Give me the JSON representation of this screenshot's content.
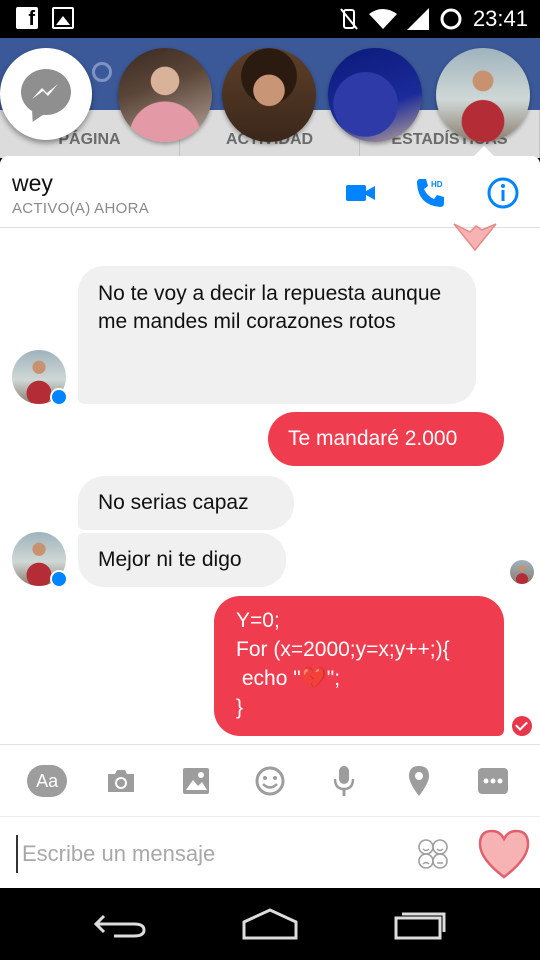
{
  "status_bar": {
    "time": "23:41"
  },
  "background_app": {
    "nav_items": [
      "PÁGINA",
      "ACTIVIDAD",
      "ESTADÍSTICAS"
    ]
  },
  "chat_header": {
    "name": "wey",
    "status": "ACTIVO(A) AHORA"
  },
  "messages": [
    {
      "from": "contact",
      "text": "No te voy a decir la repuesta aunque me mandes mil corazones rotos"
    },
    {
      "from": "me",
      "text": "Te mandaré 2.000"
    },
    {
      "from": "contact",
      "text": "No serias capaz"
    },
    {
      "from": "contact",
      "text": "Mejor ni te digo"
    },
    {
      "from": "me",
      "lines": [
        "Y=0;",
        "For (x=2000;y=x;y++;){",
        " echo \"💔\";",
        "}"
      ]
    }
  ],
  "toolbar": {
    "aa_label": "Aa",
    "tools": [
      "text-format-icon",
      "camera-icon",
      "image-icon",
      "sticker-icon",
      "microphone-icon",
      "location-icon",
      "more-icon"
    ]
  },
  "composer": {
    "placeholder": "Escribe un mensaje"
  },
  "colors": {
    "accent_blue": "#0084ff",
    "outgoing_bubble": "#f03c4f",
    "incoming_bubble": "#f1f0f0",
    "facebook_blue": "#3b5998"
  }
}
